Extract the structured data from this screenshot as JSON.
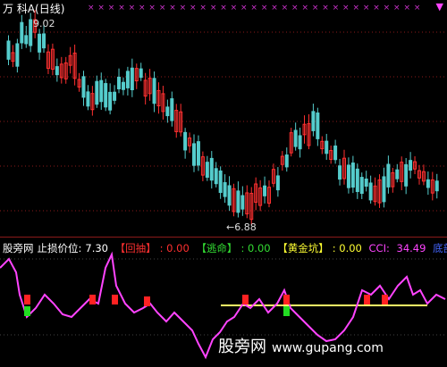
{
  "header": {
    "title": "万 科A(日线)",
    "corner_mark": "▼"
  },
  "price_chart": {
    "high_label": "9.02",
    "low_label": "←6.88",
    "up_color": "#ff3030",
    "down_color": "#55cccc",
    "grid_color": "#8b1a1a"
  },
  "indicator": {
    "name": "股旁网",
    "stop_loss_label": "止损价位:",
    "stop_loss_value": "7.30",
    "huichou_label": "【回抽】",
    "huichou_value": ": 0.00",
    "taoming_label": "【逃命】",
    "taoming_value": ": 0.00",
    "huangjinkeng_label": "【黄金坑】",
    "huangjinkeng_value": ": 0.00",
    "cci_label": "CCI: ",
    "cci_value": "34.49",
    "bottom_label": "底部",
    "cci_color": "#ff44ff",
    "golden_line_color": "#ffff66"
  },
  "watermark": {
    "text": "股旁网",
    "url": "www.gupang.com"
  }
}
